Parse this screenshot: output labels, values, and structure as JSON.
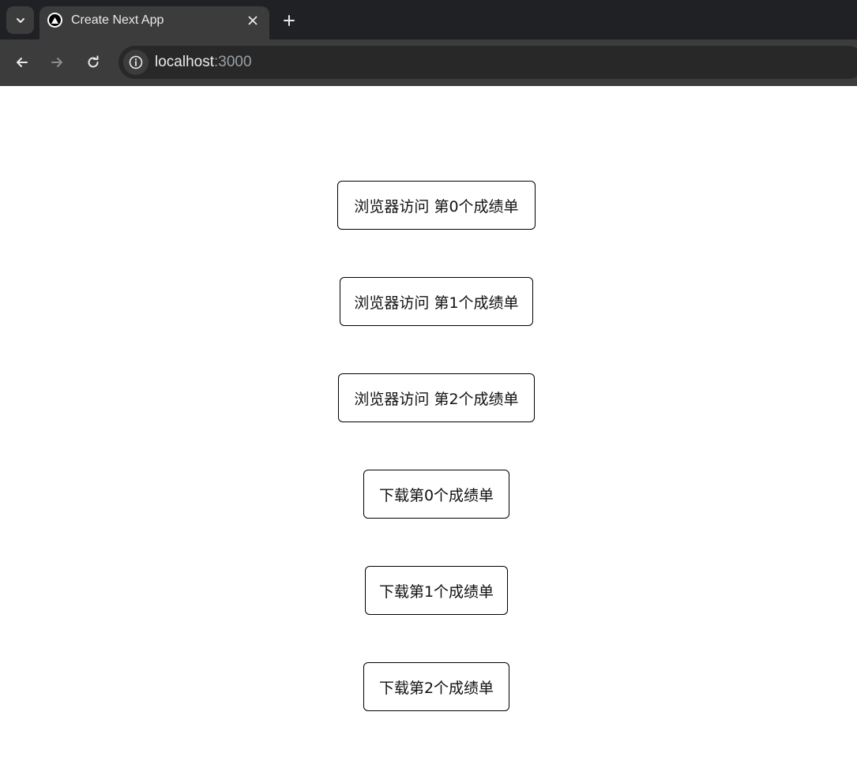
{
  "browser": {
    "tab": {
      "title": "Create Next App",
      "favicon": "nextjs-triangle-icon"
    },
    "address_bar": {
      "host": "localhost",
      "port": ":3000"
    },
    "icons": {
      "tab_search": "chevron-down-icon",
      "close_tab": "close-icon",
      "new_tab": "plus-icon",
      "back": "arrow-left-icon",
      "forward": "arrow-right-icon",
      "reload": "reload-icon",
      "site_info": "info-icon"
    },
    "colors": {
      "chrome_dark": "#202124",
      "chrome_mid": "#3c3c3c",
      "omnibox": "#282828",
      "text": "#e8eaed"
    }
  },
  "page": {
    "buttons": [
      {
        "id": "view-report-0",
        "label": "浏览器访问 第0个成绩单"
      },
      {
        "id": "view-report-1",
        "label": "浏览器访问 第1个成绩单"
      },
      {
        "id": "view-report-2",
        "label": "浏览器访问 第2个成绩单"
      },
      {
        "id": "download-report-0",
        "label": "下载第0个成绩单"
      },
      {
        "id": "download-report-1",
        "label": "下载第1个成绩单"
      },
      {
        "id": "download-report-2",
        "label": "下载第2个成绩单"
      }
    ]
  }
}
